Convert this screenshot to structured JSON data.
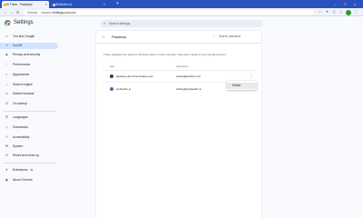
{
  "browser": {
    "tabs": [
      {
        "label": "Hi There - Passkeys",
        "active": true
      },
      {
        "label": "WebAuthn.io",
        "active": false
      }
    ],
    "new_tab": "+",
    "omnibox": {
      "chip": "Chrome",
      "path_prefix": "chrome://",
      "path_main": "settings",
      "path_suffix": "/passkeys"
    }
  },
  "header": {
    "title": "Settings",
    "search_placeholder": "Search settings"
  },
  "sidebar": {
    "items": [
      {
        "label": "You and Google",
        "icon": "person-icon",
        "glyph": "☺",
        "active": false
      },
      {
        "label": "Autofill",
        "icon": "autofill-icon",
        "glyph": "≡",
        "active": true
      },
      {
        "label": "Privacy and security",
        "icon": "shield-icon",
        "glyph": "◈",
        "active": false
      },
      {
        "label": "Performance",
        "icon": "speedometer-icon",
        "glyph": "◔",
        "active": false
      },
      {
        "label": "Appearance",
        "icon": "palette-icon",
        "glyph": "◐",
        "active": false
      },
      {
        "label": "Search engine",
        "icon": "search-icon",
        "glyph": "⌕",
        "active": false
      },
      {
        "label": "Default browser",
        "icon": "browser-icon",
        "glyph": "▭",
        "active": false
      },
      {
        "label": "On startup",
        "icon": "power-icon",
        "glyph": "⏻",
        "active": false
      },
      {
        "label": "Languages",
        "icon": "globe-icon",
        "glyph": "☷",
        "active": false
      },
      {
        "label": "Downloads",
        "icon": "download-icon",
        "glyph": "⤓",
        "active": false
      },
      {
        "label": "Accessibility",
        "icon": "accessibility-icon",
        "glyph": "⚇",
        "active": false
      },
      {
        "label": "System",
        "icon": "wrench-icon",
        "glyph": "⚒",
        "active": false
      },
      {
        "label": "Reset and clean up",
        "icon": "reset-icon",
        "glyph": "↺",
        "active": false
      },
      {
        "label": "Extensions",
        "icon": "puzzle-icon",
        "glyph": "✦",
        "active": false
      },
      {
        "label": "About Chrome",
        "icon": "chrome-logo-icon",
        "glyph": "◉",
        "active": false
      }
    ]
  },
  "passkeys": {
    "back_icon": "←",
    "title": "Passkeys",
    "search_placeholder": "Search passkeys",
    "info": "These passkeys are saved to Windows Hello on this computer. They aren't saved to your Google Account.",
    "columns": {
      "site": "Site",
      "username": "Username"
    },
    "rows": [
      {
        "site": "passkey-demo.herokuapp.com",
        "username": "testing@webn1.com",
        "color": "#3c4043"
      },
      {
        "site": "webauthn.io",
        "username": "testing@webauthn.io",
        "color": "#4a6da7"
      }
    ],
    "more_icon": "⋮"
  },
  "context_menu": {
    "items": [
      "Delete"
    ]
  }
}
